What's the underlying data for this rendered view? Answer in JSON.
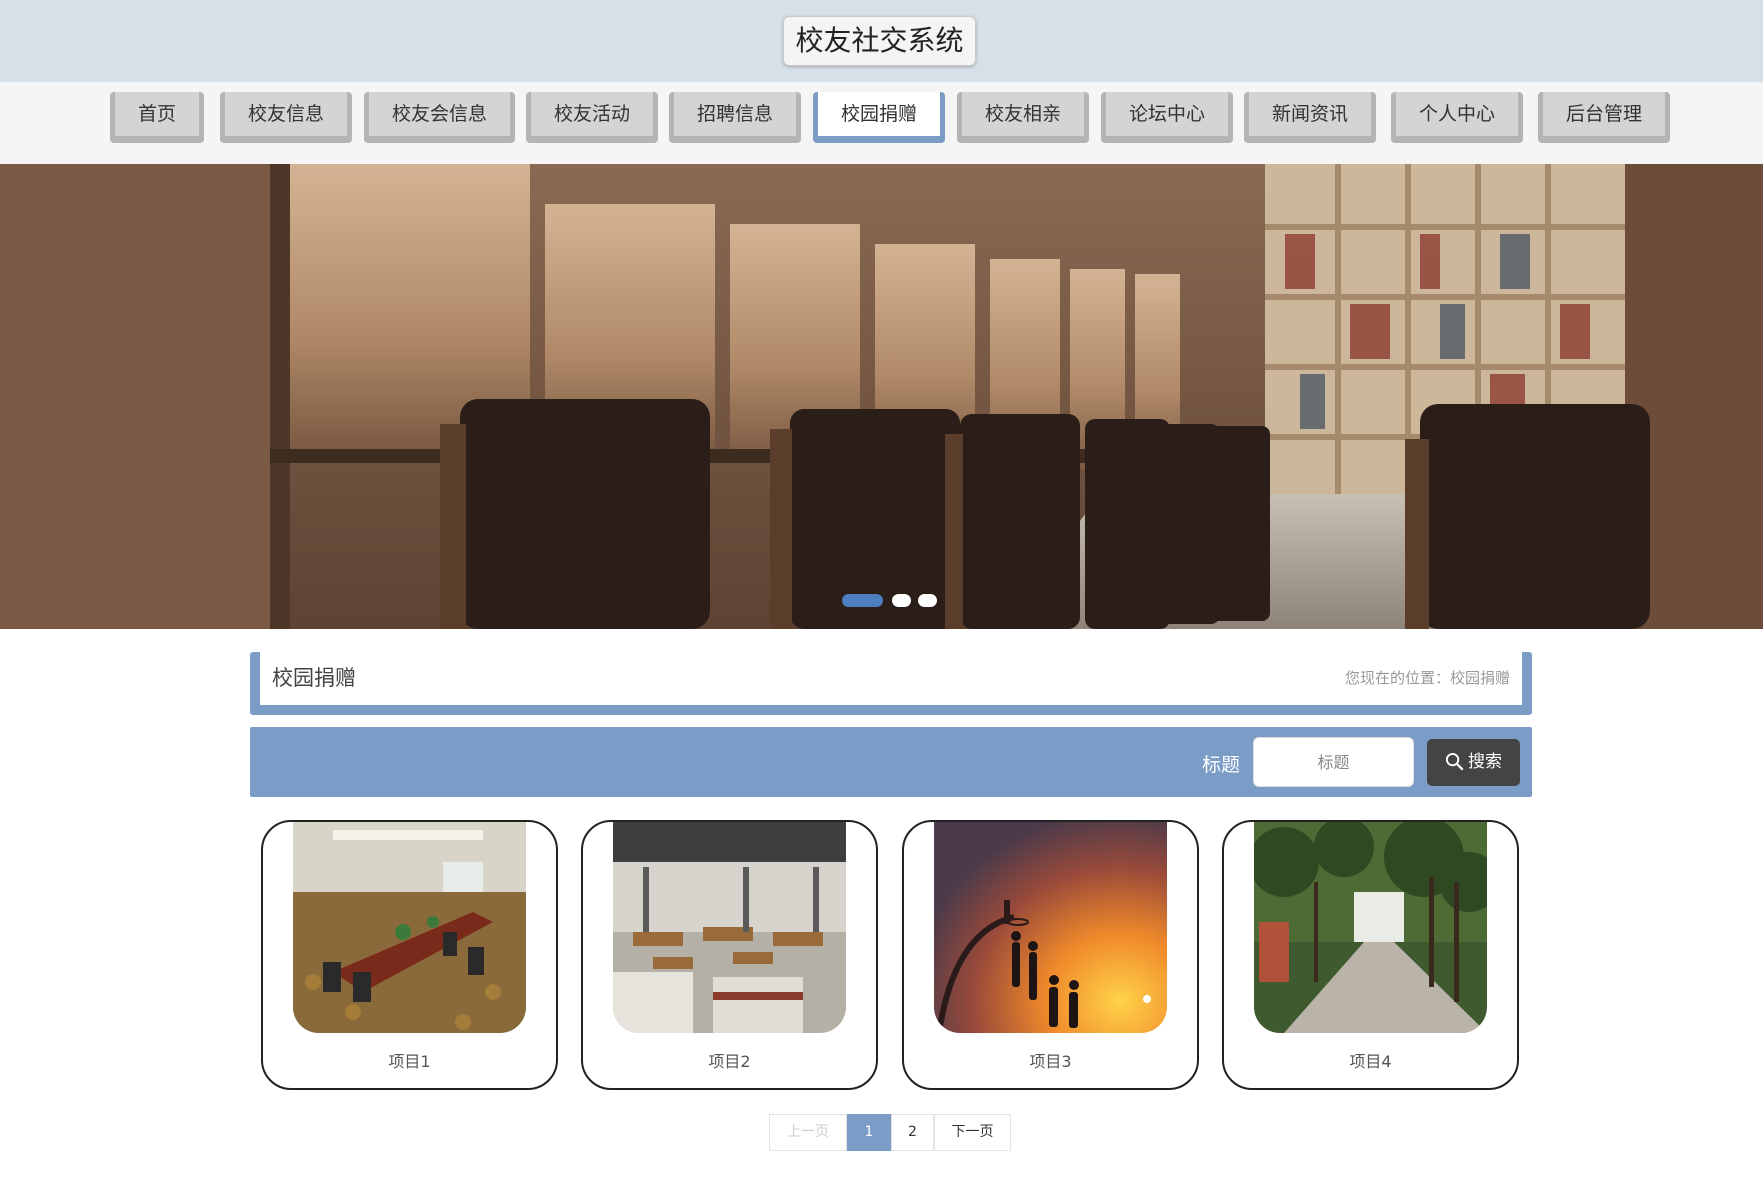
{
  "header": {
    "title": "校友社交系统"
  },
  "nav": {
    "items": [
      {
        "label": "首页"
      },
      {
        "label": "校友信息"
      },
      {
        "label": "校友会信息"
      },
      {
        "label": "校友活动"
      },
      {
        "label": "招聘信息"
      },
      {
        "label": "校园捐赠",
        "active": true
      },
      {
        "label": "校友相亲"
      },
      {
        "label": "论坛中心"
      },
      {
        "label": "新闻资讯"
      },
      {
        "label": "个人中心"
      },
      {
        "label": "后台管理"
      }
    ]
  },
  "banner": {
    "slide_count": 3,
    "active_slide": 1
  },
  "breadcrumb": {
    "title": "校园捐赠",
    "position_label": "您现在的位置：",
    "position_value": "校园捐赠"
  },
  "search": {
    "label": "标题",
    "placeholder": "标题",
    "value": "",
    "button_label": "搜索"
  },
  "cards": [
    {
      "title": "项目1",
      "image": "conference-room-photo"
    },
    {
      "title": "项目2",
      "image": "office-workspace-photo"
    },
    {
      "title": "项目3",
      "image": "basketball-sunset-photo"
    },
    {
      "title": "项目4",
      "image": "tree-lined-road-photo"
    }
  ],
  "pagination": {
    "prev_label": "上一页",
    "pages": [
      "1",
      "2"
    ],
    "current": "1",
    "next_label": "下一页"
  },
  "colors": {
    "accent": "#7b9cc6",
    "header_bg": "#d7dfe8",
    "search_button": "#444444"
  }
}
